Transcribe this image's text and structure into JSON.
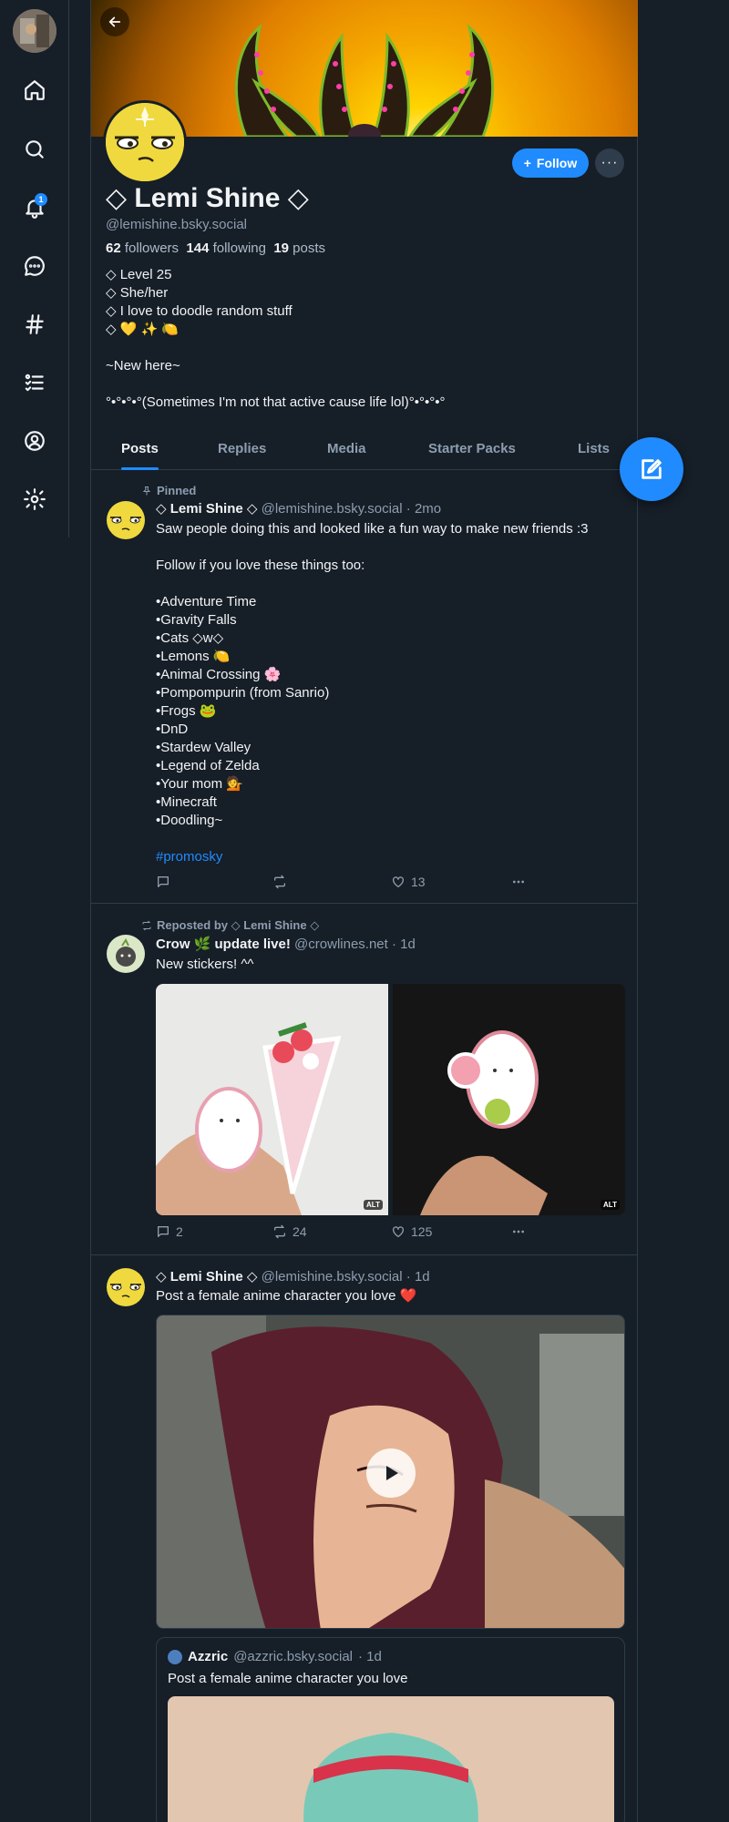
{
  "nav": {
    "items": [
      {
        "name": "home-icon"
      },
      {
        "name": "search-icon"
      },
      {
        "name": "notifications-icon"
      },
      {
        "name": "chat-icon"
      },
      {
        "name": "feeds-icon"
      },
      {
        "name": "lists-icon"
      },
      {
        "name": "profile-icon"
      },
      {
        "name": "settings-icon"
      }
    ],
    "notifications_badge": "1"
  },
  "profile": {
    "display_name": "◇ Lemi Shine ◇",
    "handle": "@lemishine.bsky.social",
    "followers_count": "62",
    "followers_label": "followers",
    "following_count": "144",
    "following_label": "following",
    "posts_count": "19",
    "posts_label": "posts",
    "follow_label": "Follow",
    "more_label": "···",
    "bio": [
      "◇ Level 25",
      "◇ She/her",
      "◇ I love to doodle random stuff",
      "◇ 💛 ✨ 🍋",
      "",
      "~New here~",
      "",
      "°•°•°•°(Sometimes I'm not that active cause life lol)°•°•°•°"
    ]
  },
  "tabs": [
    "Posts",
    "Replies",
    "Media",
    "Starter Packs",
    "Lists"
  ],
  "posts": {
    "pinned": {
      "meta": "Pinned",
      "author": "◇ Lemi Shine ◇",
      "handle": "@lemishine.bsky.social",
      "time": "· 2mo",
      "lines": [
        "Saw people doing this and looked like a fun way to make new friends :3",
        "",
        "Follow if you love these things too:",
        "",
        "•Adventure Time",
        "•Gravity Falls",
        "•Cats ◇w◇",
        "•Lemons 🍋",
        "•Animal Crossing 🌸",
        "•Pompompurin (from Sanrio)",
        "•Frogs 🐸",
        "•DnD",
        "•Stardew Valley",
        "•Legend of Zelda",
        "•Your mom 💁",
        "•Minecraft",
        "•Doodling~",
        ""
      ],
      "hashtag": "#promosky",
      "replies": "",
      "reposts": "",
      "likes": "13"
    },
    "repost": {
      "meta": "Reposted by ◇ Lemi Shine ◇",
      "author": "Crow 🌿 update live!",
      "handle": "@crowlines.net",
      "time": "· 1d",
      "text": "New stickers! ^^",
      "alt1": "ALT",
      "alt2": "ALT",
      "replies": "2",
      "reposts": "24",
      "likes": "125"
    },
    "video_post": {
      "author": "◇ Lemi Shine ◇",
      "handle": "@lemishine.bsky.social",
      "time": "· 1d",
      "text": "Post a female anime character you love ❤️",
      "quote": {
        "author": "Azzric",
        "handle": "@azzric.bsky.social",
        "time": "· 1d",
        "text": "Post a female anime character you love"
      }
    }
  },
  "colors": {
    "background": "#161e27",
    "accent": "#208bfe",
    "muted": "#8d9eb0",
    "border": "#2e3c4b"
  }
}
